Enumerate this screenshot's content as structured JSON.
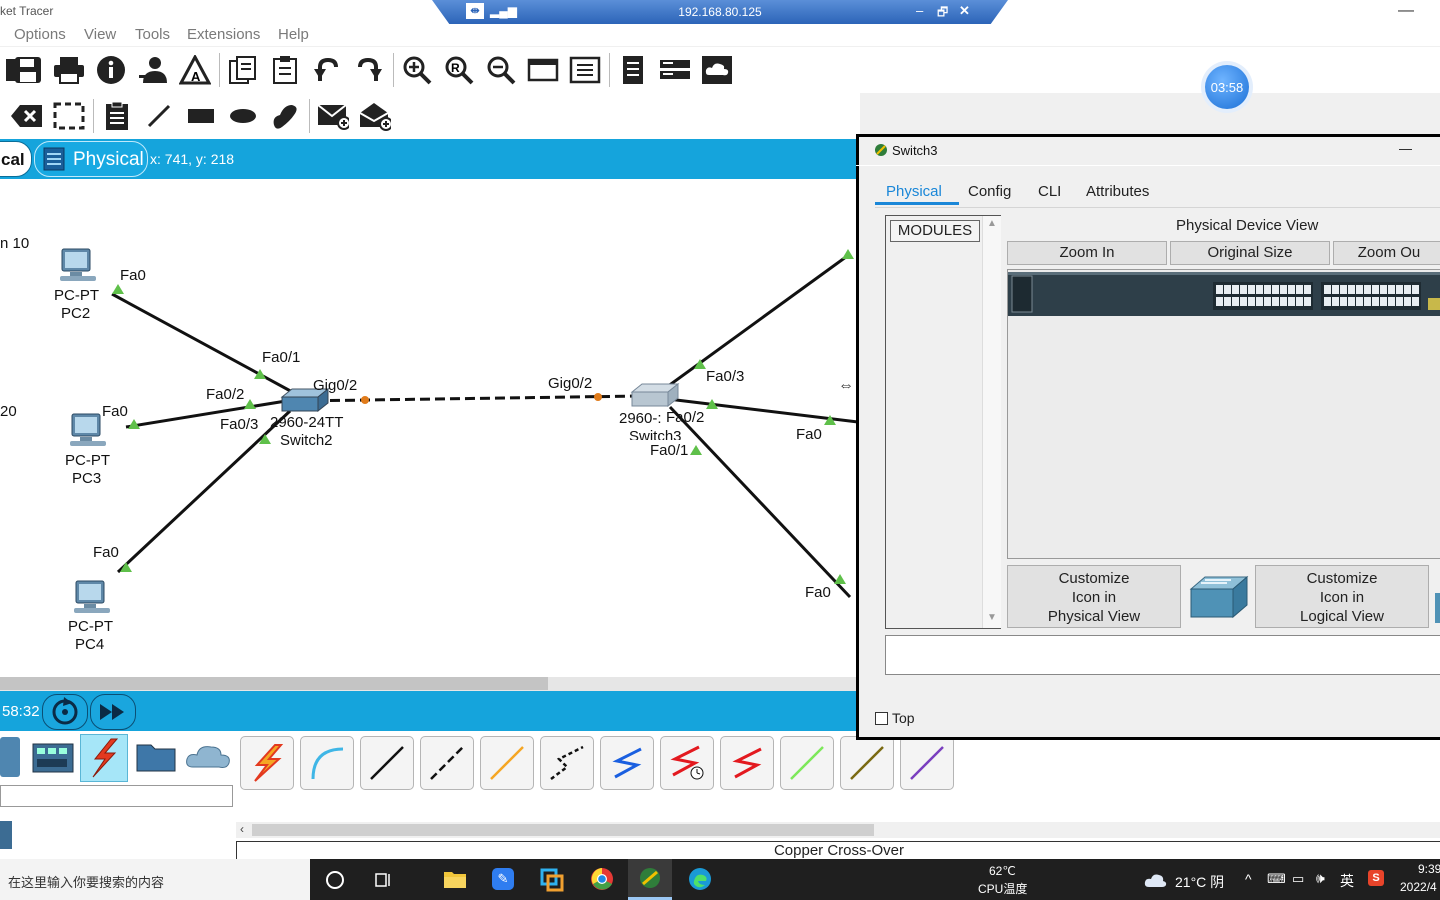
{
  "app": {
    "title": "ket Tracer"
  },
  "remote": {
    "ip": "192.168.80.125",
    "minimize": "–",
    "restore": "🗗",
    "close": "✕"
  },
  "menu": [
    "Options",
    "View",
    "Tools",
    "Extensions",
    "Help"
  ],
  "timer": "03:58",
  "view": {
    "logical_tab": "cal",
    "physical_tab": "Physical",
    "coords": "x: 741, y: 218"
  },
  "sim": {
    "time": "58:32"
  },
  "topology": {
    "edge_labels": {
      "left1": "n 10",
      "left2": "20"
    },
    "pcs": [
      {
        "type": "PC-PT",
        "name": "PC2",
        "port": "Fa0"
      },
      {
        "type": "PC-PT",
        "name": "PC3",
        "port": "Fa0"
      },
      {
        "type": "PC-PT",
        "name": "PC4",
        "port": "Fa0"
      }
    ],
    "switch2": {
      "model": "2960-24TT",
      "name": "Switch2",
      "ports": [
        "Fa0/1",
        "Fa0/2",
        "Fa0/3",
        "Gig0/2"
      ]
    },
    "switch3": {
      "model": "2960-:",
      "name": "Switch3",
      "ports": [
        "Gig0/2",
        "Fa0/3",
        "Fa0/2",
        "Fa0/1"
      ]
    },
    "right_ports": [
      "Fa0",
      "Fa0"
    ]
  },
  "dialog": {
    "title": "Switch3",
    "close": "—",
    "tabs": [
      "Physical",
      "Config",
      "CLI",
      "Attributes"
    ],
    "modules_label": "MODULES",
    "device_view_title": "Physical Device View",
    "zoom_in": "Zoom In",
    "original_size": "Original Size",
    "zoom_out": "Zoom Ou",
    "customize_physical": [
      "Customize",
      "Icon in",
      "Physical View"
    ],
    "customize_logical": [
      "Customize",
      "Icon in",
      "Logical View"
    ],
    "top_checkbox": "Top"
  },
  "status": {
    "connection": "Copper Cross-Over"
  },
  "taskbar": {
    "search_placeholder": "在这里输入你要搜索的内容",
    "cpu_temp": "62℃",
    "cpu_label": "CPU温度",
    "weather": "21°C 阴",
    "ime": "英",
    "time": "9:39",
    "date": "2022/4"
  }
}
